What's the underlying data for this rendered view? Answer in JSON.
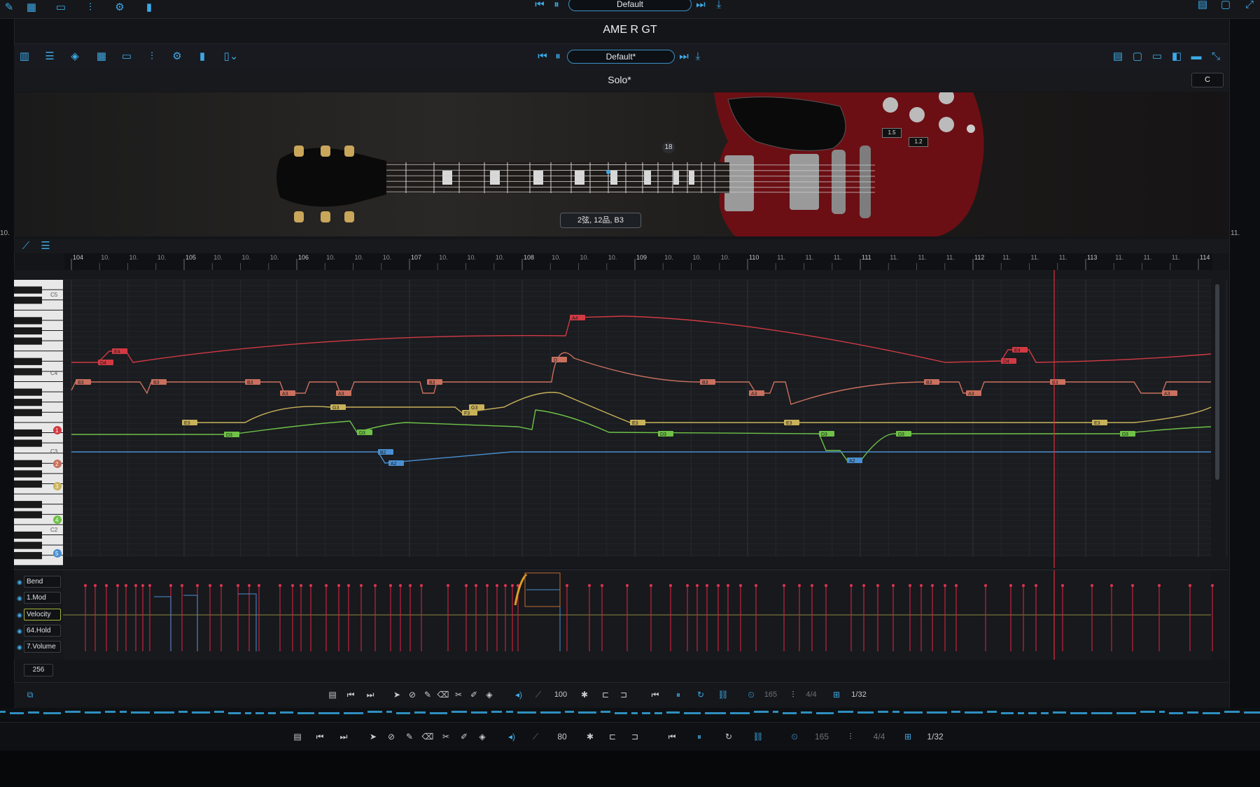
{
  "host": {
    "preset": "Default",
    "side_left_label": "10.",
    "side_right_label": "11.",
    "bottom_toolbar": {
      "tempo": "80",
      "bpm": "165",
      "meter": "4/4",
      "quantize": "1/32"
    }
  },
  "plugin": {
    "title": "AME R GT",
    "preset": "Default*",
    "patch": "Solo*",
    "key": "C",
    "fret_marker": "18",
    "knob_values": [
      "1.5",
      "1.2"
    ],
    "position_readout": "2弦, 12品, B3"
  },
  "ruler": {
    "bars": [
      "104",
      "105",
      "106",
      "107",
      "108",
      "109",
      "110",
      "111",
      "112",
      "113",
      "114"
    ],
    "sub_label": "10.",
    "sub_label_b": "11."
  },
  "piano": {
    "octave_labels": [
      "C5",
      "C4",
      "C3",
      "C2"
    ],
    "string_markers": [
      "1",
      "2",
      "3",
      "4",
      "5"
    ]
  },
  "notes": [
    {
      "label": "D4",
      "row": "red"
    },
    {
      "label": "E4",
      "row": "red"
    },
    {
      "label": "A4",
      "row": "red"
    },
    {
      "label": "B3",
      "row": "salmon"
    },
    {
      "label": "A3",
      "row": "salmon"
    },
    {
      "label": "D",
      "row": "salmon"
    },
    {
      "label": "G3",
      "row": "yellow"
    },
    {
      "label": "E3",
      "row": "yellow"
    },
    {
      "label": "F3",
      "row": "yellow"
    },
    {
      "label": "D3",
      "row": "green"
    },
    {
      "label": "B2",
      "row": "blue"
    },
    {
      "label": "A2",
      "row": "blue"
    }
  ],
  "cc_lanes": [
    "Bend",
    "1.Mod",
    "Velocity",
    "64.Hold",
    "7.Volume"
  ],
  "zoom": "256",
  "toolbar": {
    "tempo": "100",
    "bpm": "165",
    "meter": "4/4",
    "quantize": "1/32"
  },
  "colors": {
    "accent": "#3da9e6",
    "note_red": "#d23a43",
    "note_salmon": "#c9705e",
    "note_yellow": "#c9b25a",
    "note_green": "#6fc247",
    "note_blue": "#4a8fd0",
    "playhead": "#e0303a"
  }
}
